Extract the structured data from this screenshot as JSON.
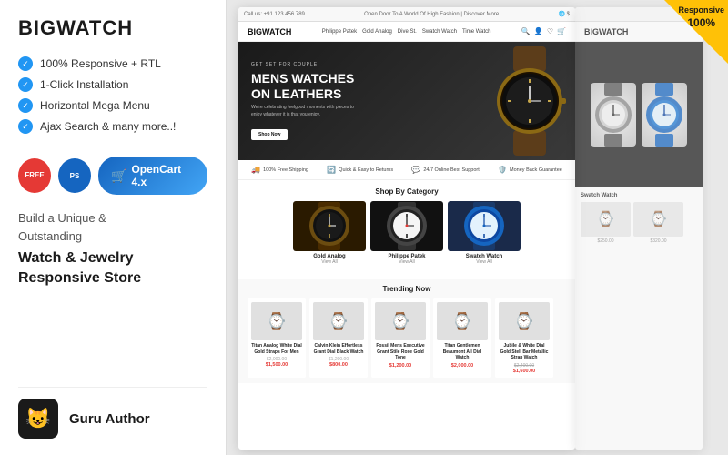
{
  "left": {
    "brand": "BIGWATCH",
    "features": [
      "100% Responsive + RTL",
      "1-Click Installation",
      "Horizontal Mega Menu",
      "Ajax Search & many more..!"
    ],
    "badges": {
      "red_label": "FREE",
      "blue_label": "PS",
      "opencart_label": "OpenCart 4.x"
    },
    "build_text": "Build a Unique &\nOutstanding",
    "highlight_text": "Watch & Jewelry\nResponsive Store",
    "author": "Guru Author"
  },
  "responsive_badge": {
    "line1": "Responsive",
    "line2": "100%"
  },
  "site": {
    "topbar_left": "Call us: +91 123 456 789",
    "topbar_right": "Open Door To A World Of High Fashion | Discover More",
    "logo": "BIGWATCH",
    "nav_links": [
      "Philippe Patek",
      "Gold Analog",
      "Dive St.",
      "Swatch Watch",
      "Time Watch"
    ],
    "hero": {
      "sub": "GET SET FOR COUPLE",
      "title": "MENS WATCHES\nON LEATHERS",
      "desc": "We're celebrating feelgood moments with pieces to enjoy whatever it is that you enjoy.",
      "btn": "Shop Now"
    },
    "features_strip": [
      {
        "icon": "🚚",
        "text": "100% Free Shipping"
      },
      {
        "icon": "🔄",
        "text": "Quick & Easy to Returns"
      },
      {
        "icon": "💬",
        "text": "24/7 Online Best Support"
      },
      {
        "icon": "🛡️",
        "text": "Money Back Guarantee"
      }
    ],
    "category_section_title": "Shop By Category",
    "categories": [
      {
        "name": "Gold Analog",
        "count": "View All",
        "color": "#8B6914"
      },
      {
        "name": "Philippe Patek",
        "count": "View All",
        "color": "#1a1a1a"
      },
      {
        "name": "Swatch Watch",
        "count": "View All",
        "color": "#2d4a7a"
      }
    ],
    "trending_title": "Trending Now",
    "products": [
      {
        "name": "Titan Analog White Dial Gold Straps For Men",
        "price": "$1,500.00",
        "old_price": "$2,000.00"
      },
      {
        "name": "Calvin Klein Effortless Grant Dial Black Watch",
        "price": "$800.00",
        "old_price": "$1,200.00"
      },
      {
        "name": "Fossil Mens Executive Grant Stile Rose Gold Tone",
        "price": "$1,200.00",
        "old_price": ""
      },
      {
        "name": "Titan Gentlemen Beaumont All Dial Watch",
        "price": "$2,000.00",
        "old_price": ""
      },
      {
        "name": "Jubile & White Dial Gold Stell Bar Metallic Strap Watch",
        "price": "$1,600.00",
        "old_price": "$2,400.00"
      }
    ]
  }
}
